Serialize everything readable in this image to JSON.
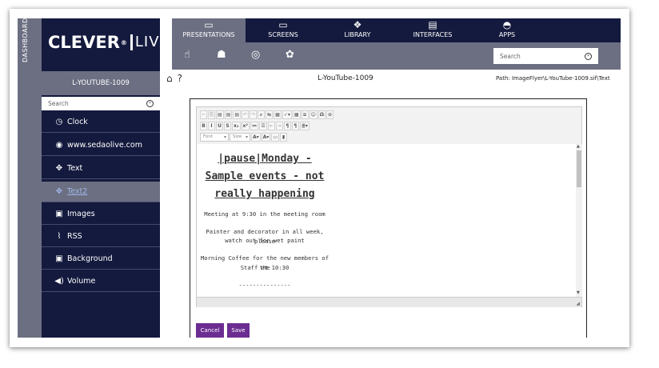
{
  "dashboard_label": "DASHBOARD",
  "logo": {
    "text": "CLEVER",
    "reg": "®",
    "live": "LIVE"
  },
  "sidebar": {
    "title": "L-YOUTUBE-1009",
    "search_placeholder": "Search",
    "items": [
      {
        "label": "Clock",
        "icon": "clock-icon"
      },
      {
        "label": "www.sedaolive.com",
        "icon": "chrome-icon"
      },
      {
        "label": "Text",
        "icon": "move-icon"
      },
      {
        "label": "Text2",
        "icon": "move-icon",
        "active": true
      },
      {
        "label": "Images",
        "icon": "image-icon"
      },
      {
        "label": "RSS",
        "icon": "rss-icon"
      },
      {
        "label": "Background",
        "icon": "image-icon"
      },
      {
        "label": "Volume",
        "icon": "volume-icon"
      }
    ]
  },
  "tabs": [
    {
      "label": "PRESENTATIONS",
      "icon": "presentation-icon",
      "active": true
    },
    {
      "label": "SCREENS",
      "icon": "screen-icon"
    },
    {
      "label": "LIBRARY",
      "icon": "library-icon"
    },
    {
      "label": "INTERFACES",
      "icon": "interfaces-icon"
    },
    {
      "label": "APPS",
      "icon": "android-icon"
    }
  ],
  "subbar_icons": [
    "hand-icon",
    "users-icon",
    "mask-icon",
    "gear-icon"
  ],
  "top_search_placeholder": "Search",
  "page_title": "L-YouTube-1009",
  "path": "Path: ImageFlyer\\L-YouTube-1009.sif\\Text",
  "toolbar": {
    "font_select": "Font",
    "size_select": "Size"
  },
  "document": {
    "heading_lines": [
      "|pause|Monday -",
      "Sample events - not",
      "really happening"
    ],
    "paragraphs": [
      [
        "Meeting at 9:30 in the meeting room"
      ],
      [
        "Painter and decorator in all week, please",
        "watch out for wet paint"
      ],
      [
        "Morning Coffee for the new members of the",
        "Staff at 10:30"
      ],
      [
        "---------------"
      ]
    ]
  },
  "buttons": {
    "cancel": "Cancel",
    "save": "Save"
  }
}
